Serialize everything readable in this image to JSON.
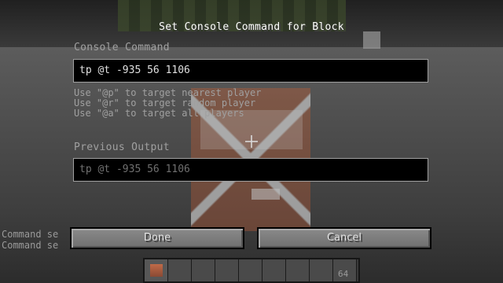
{
  "dialog": {
    "title": "Set Console Command for Block",
    "command_label": "Console Command",
    "command_value": "tp @t -935 56 1106",
    "help_lines": [
      "Use \"@p\" to target nearest player",
      "Use \"@r\" to target random player",
      "Use \"@a\" to target all players"
    ],
    "output_label": "Previous Output",
    "output_value": "tp @t -935 56 1106",
    "done_label": "Done",
    "cancel_label": "Cancel"
  },
  "chat": {
    "lines": [
      "Command se",
      "Command se"
    ]
  },
  "hotbar": {
    "selected_item": "command-block-icon",
    "count": "64"
  }
}
